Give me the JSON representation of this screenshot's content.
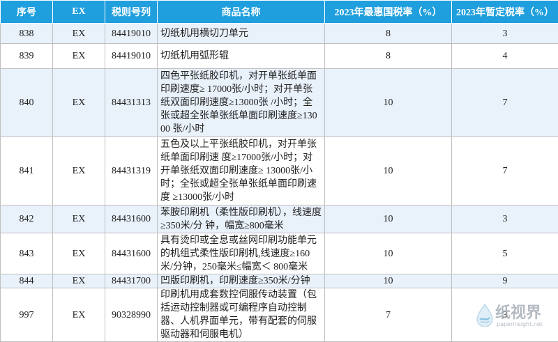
{
  "headers": [
    "序号",
    "EX",
    "税则号列",
    "商品名称",
    "2023年最惠国税率（%）",
    "2023年暂定税率（%）"
  ],
  "rows": [
    {
      "no": "838",
      "ex": "EX",
      "code": "84419010",
      "name": "切纸机用横切刀单元",
      "mfn": "8",
      "temp": "3"
    },
    {
      "no": "839",
      "ex": "EX",
      "code": "84419010",
      "name": "切纸机用弧形辊",
      "mfn": "8",
      "temp": "4"
    },
    {
      "no": "840",
      "ex": "EX",
      "code": "84431313",
      "name": "四色平张纸胶印机，对开单张纸单面印刷速度≥ 17000张/小时；对开单张纸双面印刷速度≥13000张 /小时；全张或超全张单张纸单面印刷速度≥13000 张/小时",
      "mfn": "10",
      "temp": "7"
    },
    {
      "no": "841",
      "ex": "EX",
      "code": "84431319",
      "name": "五色及以上平张纸胶印机，对开单张纸单面印刷速 度≥17000张/小时；对开单张纸双面印刷速度≥ 13000张/小时；全张或超全张单张纸单面印刷速度 ≥13000张/小时",
      "mfn": "10",
      "temp": "7"
    },
    {
      "no": "842",
      "ex": "EX",
      "code": "84431600",
      "name": "苯胺印刷机（柔性版印刷机），线速度≥350米/分 钟，幅宽≥800毫米",
      "mfn": "10",
      "temp": "3"
    },
    {
      "no": "843",
      "ex": "EX",
      "code": "84431600",
      "name": "具有烫印或全息或丝网印刷功能单元的机组式柔性版印刷机,线速度≥160米/分钟，250毫米≤幅宽＜ 800毫米",
      "mfn": "10",
      "temp": "5"
    },
    {
      "no": "844",
      "ex": "EX",
      "code": "84431700",
      "name": "凹版印刷机，印刷速度≥350米/分钟",
      "mfn": "10",
      "temp": "9"
    },
    {
      "no": "997",
      "ex": "EX",
      "code": "90328990",
      "name": "印刷机用成套数控伺服传动装置（包括运动控制器或可编程序自动控制器、人机界面单元，带有配套的伺服驱动器和伺服电机）",
      "mfn": "7",
      "temp": "3"
    }
  ],
  "watermark": {
    "text": "纸视界",
    "url": "paperinsight.net",
    "icon": "paper-drop-logo-icon"
  }
}
